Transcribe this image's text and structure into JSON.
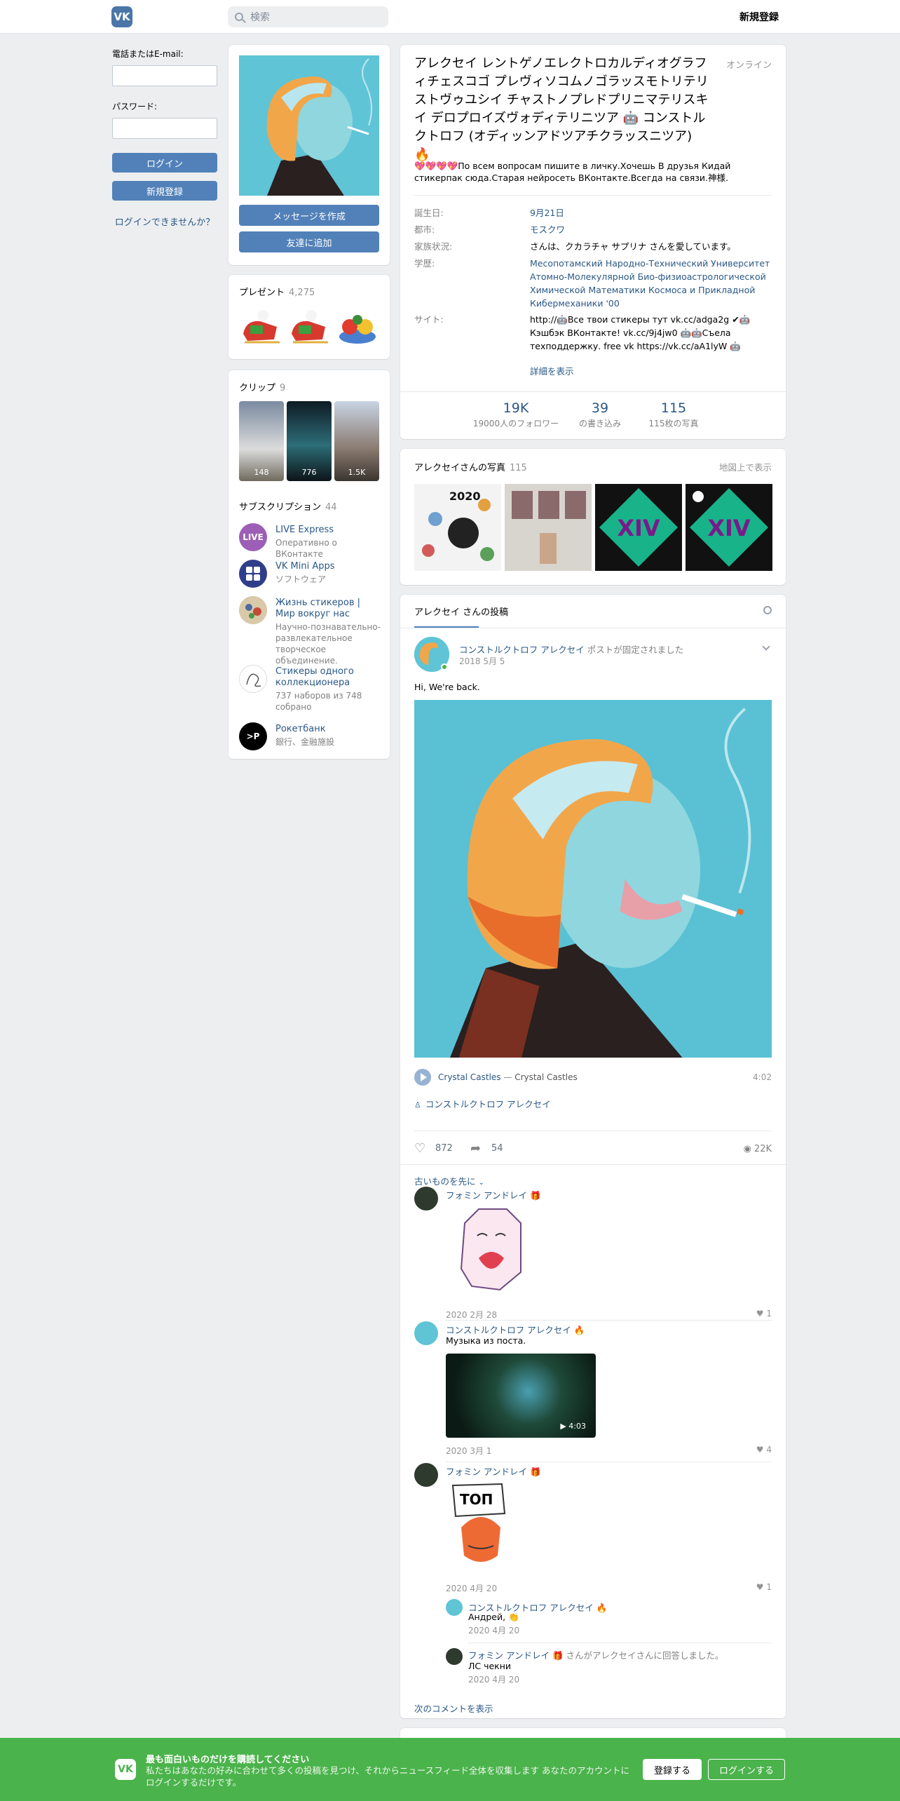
{
  "header": {
    "logo": "VK",
    "search_placeholder": "検索",
    "signup": "新規登録"
  },
  "login": {
    "phone_label": "電話またはE-mail:",
    "password_label": "パスワード:",
    "login_button": "ログイン",
    "signup_button": "新規登録",
    "forgot": "ログインできませんか？"
  },
  "profile": {
    "message_button": "メッセージを作成",
    "add_friend_button": "友達に追加",
    "name": "アレクセイ レントゲノエレクトロカルディオグラフィチェスコゴ プレヴィソコムノゴラッスモトリテリストヴゥユシイ チャストノプレドプリニマテリスキイ デロプロイズヴォディテリニツア 🤖 コンストルクトロフ (オディッンアドツアチクラッスニツア) 🔥",
    "online": "オンライン",
    "status": "💖💖💖💖По всем вопросам пишите в личку.Хочешь В друзья Кидай стикерпак сюда.Старая нейросеть ВКонтакте.Всегда на связи.神様.",
    "info": [
      {
        "key": "誕生日:",
        "value": "9月21日"
      },
      {
        "key": "都市:",
        "value": "モスクワ"
      },
      {
        "key": "家族状況:",
        "value": "さんは、クカラチャ サプリナ さんを愛しています。"
      },
      {
        "key": "学歴:",
        "value": "Месопотамский Народно-Технический Университет Атомно-Молекулярной Био-физиоастрологической Химической Математики Космоса и Прикладной Кибермеханики '00"
      },
      {
        "key": "サイト:",
        "value": "http://🤖Все твои стикеры тут vk.cc/adga2g ✔🤖Кэшбэк ВКонтакте! vk.cc/9j4jw0 🤖🤖Съела техподдержку. free vk https://vk.cc/aA1lyW 🤖"
      }
    ],
    "more": "詳細を表示",
    "counters": [
      {
        "num": "19K",
        "label": "19000人のフォロワー"
      },
      {
        "num": "39",
        "label": "の書き込み"
      },
      {
        "num": "115",
        "label": "115枚の写真"
      }
    ]
  },
  "gifts": {
    "title": "プレゼント",
    "count": "4,275"
  },
  "clips": {
    "title": "クリップ",
    "count": "9",
    "items": [
      {
        "views": "148"
      },
      {
        "views": "776"
      },
      {
        "views": "1.5K"
      }
    ]
  },
  "subscriptions": {
    "title": "サブスクリプション",
    "count": "44",
    "items": [
      {
        "name": "LIVE Express",
        "desc": "Оперативно о ВКонтакте",
        "icon": "LIVE"
      },
      {
        "name": "VK Mini Apps",
        "desc": "ソフトウェア",
        "icon": "apps"
      },
      {
        "name": "Жизнь стикеров | Мир вокруг нас",
        "desc": "Научно-познавательно-развлекательное творческое объединение.",
        "icon": "stickers"
      },
      {
        "name": "Стикеры одного коллекционера",
        "desc": "737 наборов из 748 собрано",
        "icon": "collector"
      },
      {
        "name": "Рокетбанк",
        "desc": "銀行、金融施設",
        "icon": ">P"
      }
    ]
  },
  "photos": {
    "title": "アレクセイさんの写真",
    "count": "115",
    "map_link": "地図上で表示",
    "year_label": "2020"
  },
  "wall": {
    "tab": "アレクセイ さんの投稿",
    "post": {
      "author": "コンストルクトロフ アレクセイ",
      "pinned": "ポストが固定されました",
      "date": "2018 5月 5",
      "text": "Hi, We're back.",
      "audio_artist": "Crystal Castles",
      "audio_sep": "—",
      "audio_title": "Crystal Castles",
      "audio_duration": "4:02",
      "signer": "コンストルクトロフ アレクセイ",
      "likes": "872",
      "shares": "54",
      "views": "22K"
    },
    "sort_label": "古いものを先に",
    "comments": [
      {
        "name": "フォミン アンドレイ 🎁",
        "date": "2020 2月 28",
        "likes": "1",
        "text": ""
      },
      {
        "name": "コンストルクトロフ アレクセイ 🔥",
        "text": "Музыка из поста.",
        "video_duration": "4:03",
        "date": "2020 3月 1",
        "likes": "4"
      },
      {
        "name": "フォミン アンドレイ 🎁",
        "date": "2020 4月 20",
        "likes": "1",
        "text": "",
        "sticker_text": "ТОП"
      }
    ],
    "replies": [
      {
        "name": "コンストルクトロフ アレクセイ 🔥",
        "text": "Андрей, 👏",
        "date": "2020 4月 20",
        "extra": ""
      },
      {
        "name": "フォミン アンドレイ 🎁",
        "extra": "さんがアレクセイさんに回答しました。",
        "text": "ЛС чекни",
        "date": "2020 4月 20"
      }
    ],
    "more_comments": "次のコメントを表示"
  },
  "banner": {
    "title": "最も面白いものだけを購読してください",
    "text": "私たちはあなたの好みに合わせて多くの投稿を見つけ、それからニュースフィード全体を収集します あなたのアカウントにログインするだけです。",
    "signup": "登録する",
    "login": "ログインする"
  }
}
